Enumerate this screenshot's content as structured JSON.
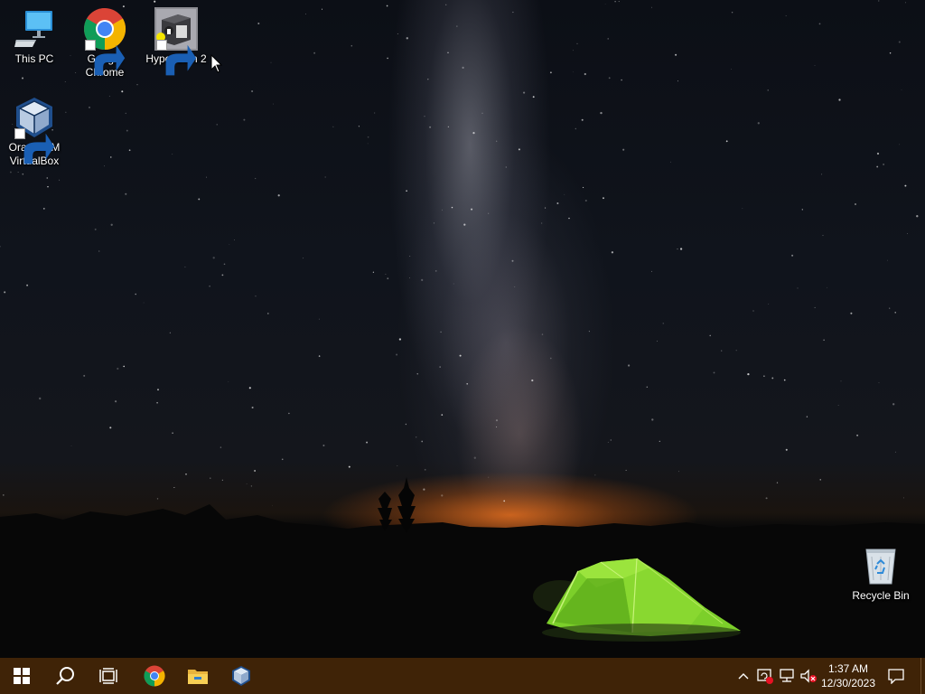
{
  "desktop": {
    "icons": [
      {
        "name": "This PC",
        "label_line1": "This PC",
        "label_line2": ""
      },
      {
        "name": "Google Chrome",
        "label_line1": "Google",
        "label_line2": "Chrome"
      },
      {
        "name": "HyperCam 2",
        "label_line1": "HyperCam 2",
        "label_line2": ""
      },
      {
        "name": "Oracle VM VirtualBox",
        "label_line1": "Oracle VM",
        "label_line2": "VirtualBox"
      },
      {
        "name": "Recycle Bin",
        "label_line1": "Recycle Bin",
        "label_line2": ""
      }
    ],
    "wallpaper": "milky-way-night-sky-with-green-tent"
  },
  "taskbar": {
    "background_color": "#3f2307",
    "buttons": [
      {
        "icon": "windows-start-icon"
      },
      {
        "icon": "search-icon"
      },
      {
        "icon": "task-view-icon"
      },
      {
        "icon": "chrome-icon"
      },
      {
        "icon": "file-explorer-icon"
      },
      {
        "icon": "virtualbox-icon"
      }
    ],
    "tray": {
      "icons": [
        "chevron-up-icon",
        "windows-update-icon",
        "network-icon",
        "volume-muted-icon"
      ],
      "time": "1:37 AM",
      "date": "12/30/2023",
      "notification_icon": "action-center-icon"
    }
  }
}
